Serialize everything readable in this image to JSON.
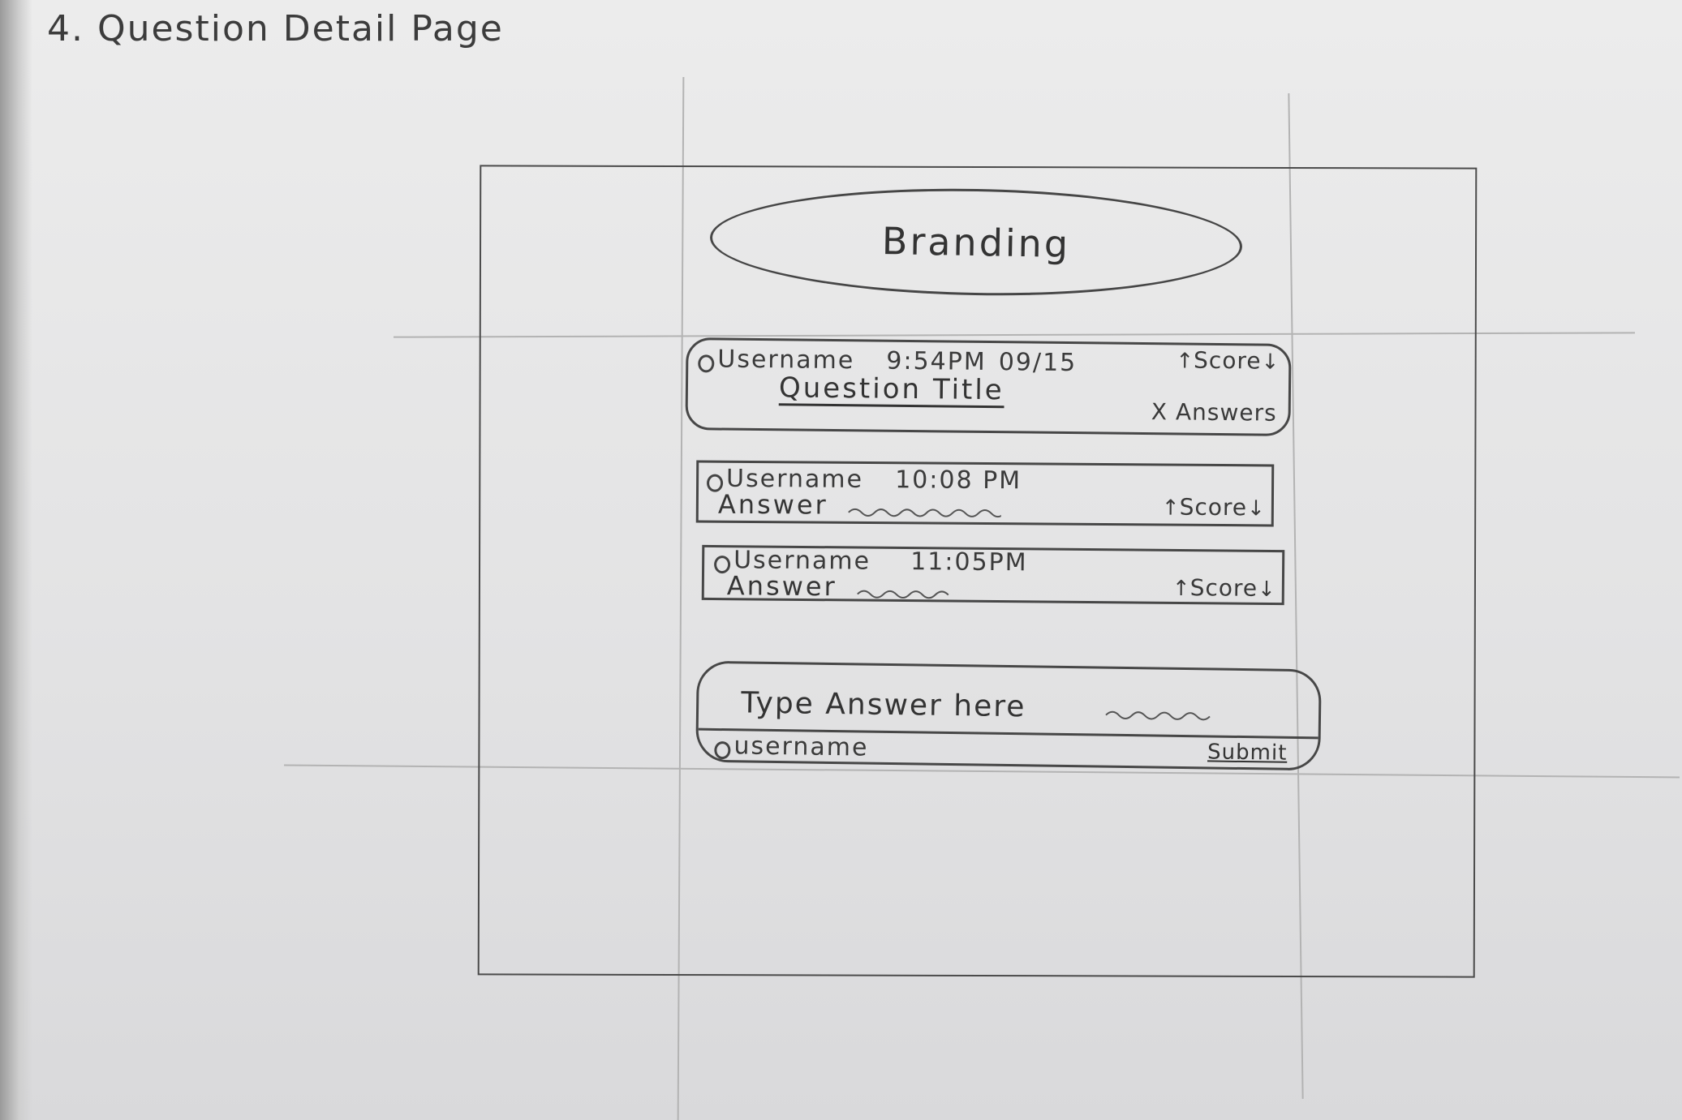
{
  "sheet_title": "4. Question Detail Page",
  "header": {
    "branding": "Branding"
  },
  "question": {
    "username": "Username",
    "time": "9:54PM",
    "date": "09/15",
    "score_label": "Score",
    "title": "Question Title",
    "answers_count": "X Answers"
  },
  "answers": [
    {
      "username": "Username",
      "time": "10:08 PM",
      "text": "Answer",
      "score_label": "Score"
    },
    {
      "username": "Username",
      "time": "11:05PM",
      "text": "Answer",
      "score_label": "Score"
    }
  ],
  "answer_form": {
    "placeholder": "Type Answer here",
    "username": "username",
    "submit_label": "Submit"
  },
  "icons": {
    "upvote": "arrow-up",
    "downvote": "arrow-down",
    "avatar": "circle"
  },
  "colors": {
    "paper": "#e6e6e7",
    "pencil": "#3a3a3a",
    "guide_lines": "#b3b3b3"
  }
}
